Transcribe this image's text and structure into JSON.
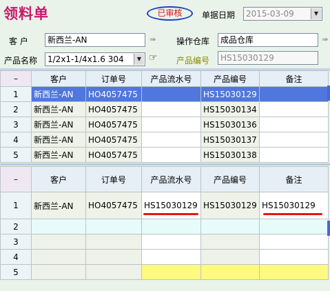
{
  "header": {
    "title": "领料单",
    "status_stamp": "已审核",
    "date_label": "单据日期",
    "date_value": "2015-03-09"
  },
  "form": {
    "customer_label": "客  户",
    "customer_value": "新西兰-AN",
    "warehouse_label": "操作仓库",
    "warehouse_value": "成品仓库",
    "product_name_label": "产品名称",
    "product_name_value": "1/2x1-1/4x1.6 304",
    "product_code_label": "产品编号",
    "product_code_value": "HS15030129"
  },
  "top_table": {
    "corner": "–",
    "columns": [
      "客户",
      "订单号",
      "产品流水号",
      "产品编号",
      "备注"
    ],
    "rows": [
      {
        "num": "1",
        "customer": "新西兰-AN",
        "order": "HO4057475",
        "serial": "",
        "code": "HS15030129",
        "note": ""
      },
      {
        "num": "2",
        "customer": "新西兰-AN",
        "order": "HO4057475",
        "serial": "",
        "code": "HS15030134",
        "note": ""
      },
      {
        "num": "3",
        "customer": "新西兰-AN",
        "order": "HO4057475",
        "serial": "",
        "code": "HS15030136",
        "note": ""
      },
      {
        "num": "4",
        "customer": "新西兰-AN",
        "order": "HO4057475",
        "serial": "",
        "code": "HS15030137",
        "note": ""
      },
      {
        "num": "5",
        "customer": "新西兰-AN",
        "order": "HO4057475",
        "serial": "",
        "code": "HS15030138",
        "note": ""
      }
    ]
  },
  "bottom_table": {
    "corner": "–",
    "columns": [
      "客户",
      "订单号",
      "产品流水号",
      "产品编号",
      "备注"
    ],
    "rows": [
      {
        "num": "1",
        "customer": "新西兰-AN",
        "order": "HO4057475",
        "serial": "HS15030129",
        "code": "HS15030129",
        "note": "HS15030129"
      },
      {
        "num": "2"
      },
      {
        "num": "3"
      },
      {
        "num": "4"
      },
      {
        "num": "5"
      }
    ]
  },
  "colors": {
    "title": "#c81a6a",
    "stamp_border": "#1b3fbf",
    "stamp_text": "#d81414",
    "selected_row": "#4f77de",
    "highlight_row": "#fff97f",
    "annotation_underline": "#ee1111"
  }
}
